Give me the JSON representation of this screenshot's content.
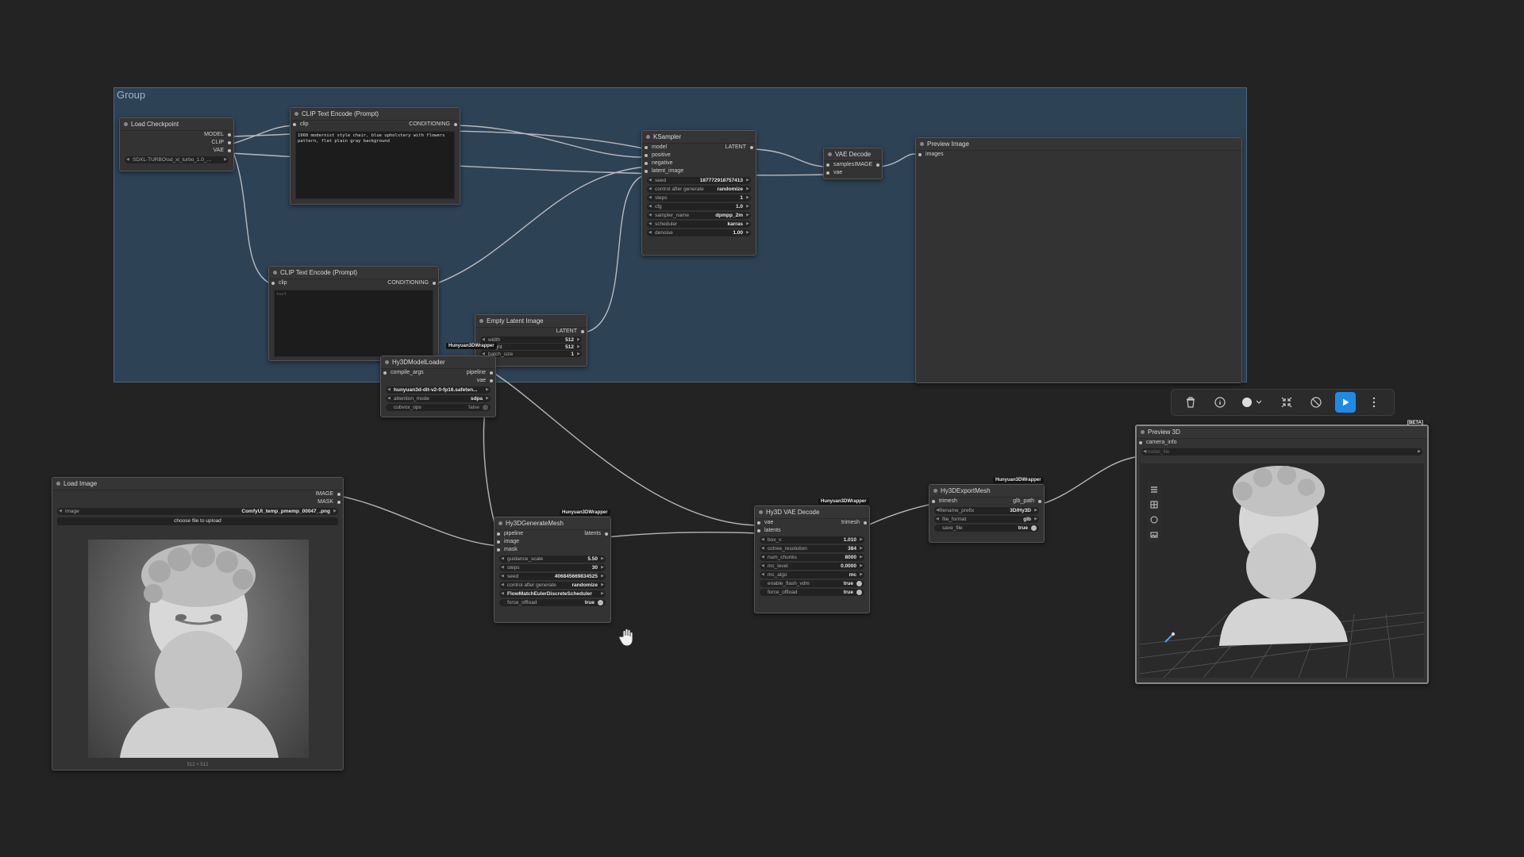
{
  "group": {
    "title": "Group"
  },
  "load_checkpoint": {
    "title": "Load Checkpoint",
    "outputs": [
      "MODEL",
      "CLIP",
      "VAE"
    ],
    "ckpt": "SDXL-TURBO\\sd_xl_turbo_1.0_..."
  },
  "clip_pos": {
    "title": "CLIP Text Encode (Prompt)",
    "input": "clip",
    "output": "CONDITIONING",
    "text": "1960 modernist style chair, blue upholstery with flowers pattern, flat plain gray background"
  },
  "clip_neg": {
    "title": "CLIP Text Encode (Prompt)",
    "input": "clip",
    "output": "CONDITIONING",
    "text": "text"
  },
  "ksampler": {
    "title": "KSampler",
    "inputs": [
      "model",
      "positive",
      "negative",
      "latent_image"
    ],
    "output": "LATENT",
    "widgets": [
      {
        "k": "seed",
        "v": "187772918757413"
      },
      {
        "k": "control after generate",
        "v": "randomize"
      },
      {
        "k": "steps",
        "v": "1"
      },
      {
        "k": "cfg",
        "v": "1.0"
      },
      {
        "k": "sampler_name",
        "v": "dpmpp_2m"
      },
      {
        "k": "scheduler",
        "v": "karras"
      },
      {
        "k": "denoise",
        "v": "1.00"
      }
    ]
  },
  "vae_decode": {
    "title": "VAE Decode",
    "inputs": [
      "samples",
      "vae"
    ],
    "output": "IMAGE"
  },
  "preview_image": {
    "title": "Preview Image",
    "input": "images"
  },
  "empty_latent": {
    "title": "Empty Latent Image",
    "output": "LATENT",
    "widgets": [
      {
        "k": "width",
        "v": "512"
      },
      {
        "k": "height",
        "v": "512"
      },
      {
        "k": "batch_size",
        "v": "1"
      }
    ]
  },
  "model_loader": {
    "tag": "Hunyuan3DWrapper",
    "title": "Hy3DModelLoader",
    "inputs": [
      "compile_args"
    ],
    "outputs": [
      "pipeline",
      "vae"
    ],
    "widgets": [
      {
        "k": "",
        "v": "hunyuan3d-dit-v2-0-fp16.safeten..."
      },
      {
        "k": "attention_mode",
        "v": "sdpa"
      },
      {
        "k": "cubvox_ops",
        "v": "false"
      }
    ]
  },
  "load_image": {
    "title": "Load Image",
    "outputs": [
      "IMAGE",
      "MASK"
    ],
    "image_label": "image",
    "image_value": "ComfyUI_temp_pmemp_00047_.png",
    "upload_label": "choose file to upload",
    "dims": "512 × 512"
  },
  "generate_mesh": {
    "tag": "Hunyuan3DWrapper",
    "title": "Hy3DGenerateMesh",
    "inputs": [
      "pipeline",
      "image",
      "mask"
    ],
    "output": "latents",
    "widgets": [
      {
        "k": "guidance_scale",
        "v": "5.50"
      },
      {
        "k": "steps",
        "v": "30"
      },
      {
        "k": "seed",
        "v": "406845669834525"
      },
      {
        "k": "control after generate",
        "v": "randomize"
      },
      {
        "k": "",
        "v": "FlowMatchEulerDiscreteScheduler"
      }
    ],
    "toggle": {
      "k": "force_offload",
      "v": "true"
    }
  },
  "vae_decode3d": {
    "tag": "Hunyuan3DWrapper",
    "title": "Hy3D VAE Decode",
    "inputs": [
      "vae",
      "latents"
    ],
    "output": "trimesh",
    "widgets": [
      {
        "k": "box_v",
        "v": "1.010"
      },
      {
        "k": "octree_resolution",
        "v": "384"
      },
      {
        "k": "num_chunks",
        "v": "8000"
      },
      {
        "k": "mc_level",
        "v": "0.0000"
      },
      {
        "k": "mc_algo",
        "v": "mc"
      }
    ],
    "toggles": [
      {
        "k": "enable_flash_vdm",
        "v": "true"
      },
      {
        "k": "force_offload",
        "v": "true"
      }
    ]
  },
  "export_mesh": {
    "tag": "Hunyuan3DWrapper",
    "title": "Hy3DExportMesh",
    "input": "trimesh",
    "output": "glb_path",
    "filename_prefix": {
      "k": "filename_prefix",
      "v": "3D/Hy3D"
    },
    "file_format": {
      "k": "file_format",
      "v": "glb"
    },
    "save_file": {
      "k": "save_file",
      "v": "true"
    }
  },
  "preview3d": {
    "tag": "[BETA]",
    "title": "Preview 3D",
    "inputs": [
      "camera_info"
    ],
    "model_file": "model_file"
  }
}
